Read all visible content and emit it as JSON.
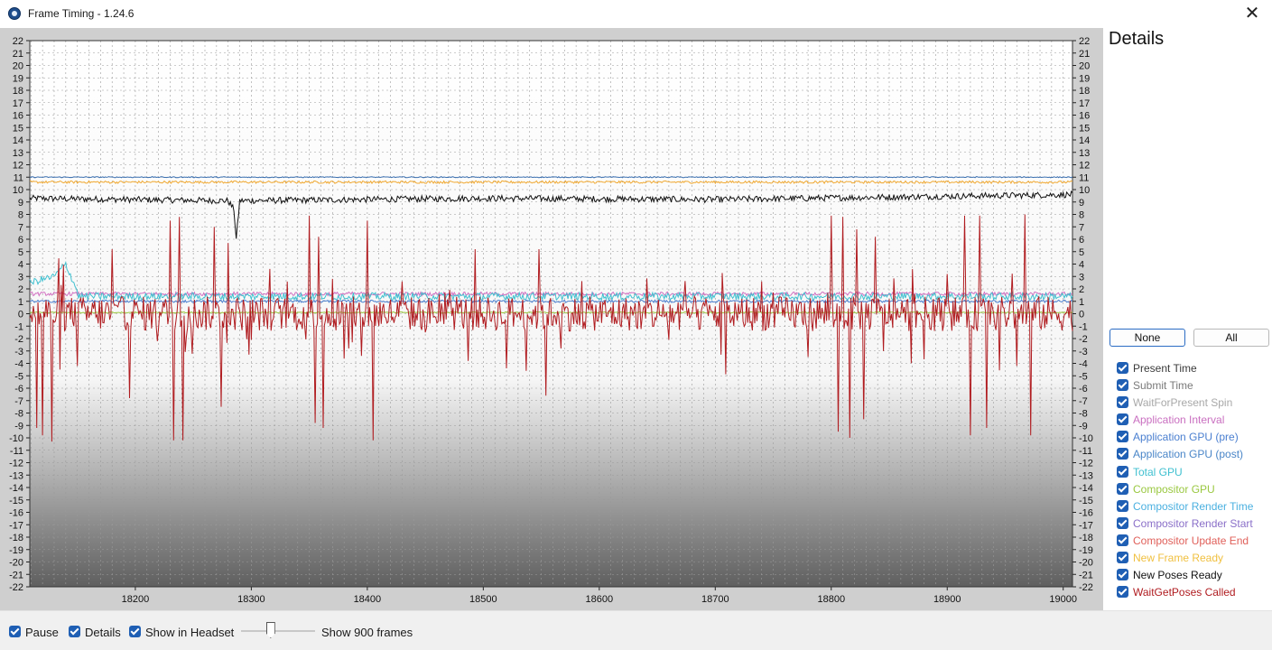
{
  "window": {
    "title": "Frame Timing - 1.24.6",
    "close_glyph": "✕"
  },
  "chart_data": {
    "type": "line",
    "ylim": [
      -22,
      22
    ],
    "xlim": [
      18109,
      19008
    ],
    "x_ticks": [
      18200,
      18300,
      18400,
      18500,
      18600,
      18700,
      18800,
      18900,
      19000
    ],
    "y_ticks": [
      -22,
      -21,
      -20,
      -19,
      -18,
      -17,
      -16,
      -15,
      -14,
      -13,
      -12,
      -11,
      -10,
      -9,
      -8,
      -7,
      -6,
      -5,
      -4,
      -3,
      -2,
      -1,
      0,
      1,
      2,
      3,
      4,
      5,
      6,
      7,
      8,
      9,
      10,
      11,
      12,
      13,
      14,
      15,
      16,
      17,
      18,
      19,
      20,
      21,
      22
    ],
    "grid": true,
    "series": [
      {
        "name": "New Poses Ready",
        "color": "#111111",
        "baseline": 9.5,
        "noise": 0.25,
        "events": [
          [
            18109,
            9.3
          ],
          [
            18280,
            9.1
          ],
          [
            18285,
            8.4
          ],
          [
            18287,
            6.0
          ],
          [
            18290,
            9.1
          ],
          [
            18500,
            9.3
          ],
          [
            18700,
            9.2
          ],
          [
            19008,
            9.6
          ]
        ]
      },
      {
        "name": "New Frame Ready",
        "color": "#f0a830",
        "baseline": 10.6,
        "noise": 0.1
      },
      {
        "name": "Present Time",
        "color": "#3a6fb0",
        "baseline": 11.0,
        "noise": 0.04
      },
      {
        "name": "Application Interval",
        "color": "#d06fc0",
        "baseline": 1.6,
        "noise": 0.15
      },
      {
        "name": "Total GPU",
        "color": "#40c0d0",
        "baseline": 1.4,
        "noise": 0.3,
        "events": [
          [
            18109,
            2.5
          ],
          [
            18130,
            3.0
          ],
          [
            18140,
            4.0
          ],
          [
            18150,
            1.8
          ]
        ]
      },
      {
        "name": "Application GPU (pre)",
        "color": "#4a7fd0",
        "baseline": 1.0,
        "noise": 0.1
      },
      {
        "name": "Compositor GPU",
        "color": "#9ac840",
        "baseline": 0.1,
        "noise": 0.05
      },
      {
        "name": "WaitGetPoses Called",
        "color": "#b01c20",
        "baseline": 0.0,
        "noise": 1.4,
        "spikes": [
          [
            18115,
            -9.2
          ],
          [
            18120,
            -9.8
          ],
          [
            18128,
            -10.3
          ],
          [
            18135,
            -4.5
          ],
          [
            18150,
            -4.2
          ],
          [
            18180,
            5.2
          ],
          [
            18195,
            -6.8
          ],
          [
            18230,
            7.5
          ],
          [
            18233,
            -10.2
          ],
          [
            18238,
            7.8
          ],
          [
            18241,
            -10.2
          ],
          [
            18268,
            7.0
          ],
          [
            18274,
            -7.5
          ],
          [
            18280,
            5.7
          ],
          [
            18300,
            -2.1
          ],
          [
            18350,
            7.9
          ],
          [
            18355,
            -8.8
          ],
          [
            18358,
            6.2
          ],
          [
            18362,
            -9.2
          ],
          [
            18400,
            7.5
          ],
          [
            18405,
            -10.2
          ],
          [
            18430,
            2.6
          ],
          [
            18450,
            -1.5
          ],
          [
            18493,
            5.2
          ],
          [
            18520,
            -4.4
          ],
          [
            18548,
            5.2
          ],
          [
            18554,
            -6.6
          ],
          [
            18660,
            -2.1
          ],
          [
            18705,
            -3.3
          ],
          [
            18740,
            2.6
          ],
          [
            18800,
            7.9
          ],
          [
            18806,
            -9.5
          ],
          [
            18810,
            7.8
          ],
          [
            18816,
            -10.0
          ],
          [
            18822,
            6.8
          ],
          [
            18828,
            -8.5
          ],
          [
            18838,
            6.2
          ],
          [
            18845,
            -3.0
          ],
          [
            18900,
            3.2
          ],
          [
            18915,
            7.9
          ],
          [
            18920,
            -9.8
          ],
          [
            18928,
            7.9
          ],
          [
            18934,
            -9.2
          ],
          [
            18960,
            -4.2
          ],
          [
            18967,
            8.0
          ],
          [
            18972,
            -9.8
          ]
        ]
      }
    ]
  },
  "details": {
    "title": "Details",
    "none_label": "None",
    "all_label": "All",
    "legend": [
      {
        "label": "Present Time",
        "color": "#3a3a3a"
      },
      {
        "label": "Submit Time",
        "color": "#7a7a7a"
      },
      {
        "label": "WaitForPresent Spin",
        "color": "#a8a8a8"
      },
      {
        "label": "Application Interval",
        "color": "#c96fc0"
      },
      {
        "label": "Application GPU (pre)",
        "color": "#4a7fd0"
      },
      {
        "label": "Application GPU (post)",
        "color": "#4a86c8"
      },
      {
        "label": "Total GPU",
        "color": "#40c0d0"
      },
      {
        "label": "Compositor GPU",
        "color": "#9ac840"
      },
      {
        "label": "Compositor Render Time",
        "color": "#4ab0e0"
      },
      {
        "label": "Compositor Render Start",
        "color": "#8a6fc8"
      },
      {
        "label": "Compositor Update End",
        "color": "#e0605a"
      },
      {
        "label": "New Frame Ready",
        "color": "#f0c040"
      },
      {
        "label": "New Poses Ready",
        "color": "#111111"
      },
      {
        "label": "WaitGetPoses Called",
        "color": "#b01c20"
      }
    ]
  },
  "footer": {
    "pause_label": "Pause",
    "details_label": "Details",
    "headset_label": "Show in Headset",
    "frames_label": "Show 900 frames",
    "slider_fraction": 0.4
  }
}
